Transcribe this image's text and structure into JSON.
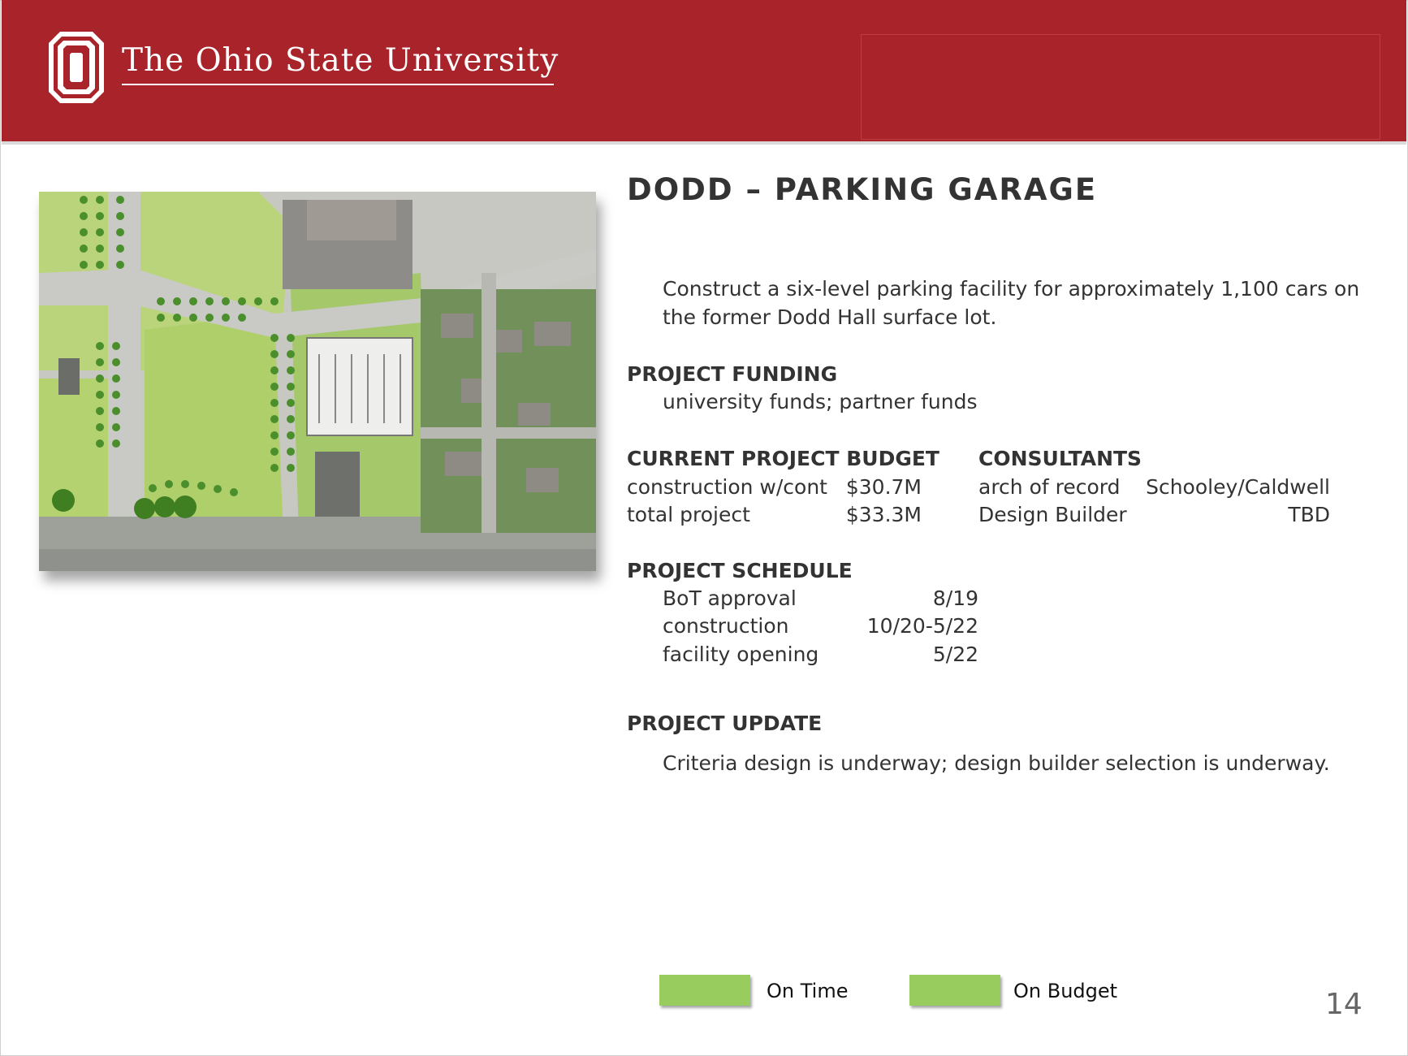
{
  "header": {
    "university_name": "The Ohio State University",
    "logo_icon": "block-o-logo-icon",
    "brand_color": "#a8232a"
  },
  "map": {
    "icon": "aerial-site-map-icon"
  },
  "title": "DODD – PARKING GARAGE",
  "description": "Construct a six-level parking facility for approximately 1,100 cars on the former Dodd Hall surface lot.",
  "funding": {
    "heading": "PROJECT FUNDING",
    "text": "university funds; partner funds"
  },
  "budget": {
    "heading": "CURRENT PROJECT BUDGET",
    "rows": [
      {
        "label": "construction w/cont",
        "value": "$30.7M"
      },
      {
        "label": "total project",
        "value": "$33.3M"
      }
    ]
  },
  "consultants": {
    "heading": "CONSULTANTS",
    "rows": [
      {
        "label": "arch of record",
        "value": "Schooley/Caldwell"
      },
      {
        "label": "Design Builder",
        "value": "TBD"
      }
    ]
  },
  "schedule": {
    "heading": "PROJECT SCHEDULE",
    "rows": [
      {
        "label": "BoT approval",
        "value": "8/19"
      },
      {
        "label": "construction",
        "value": "10/20-5/22"
      },
      {
        "label": "facility opening",
        "value": "5/22"
      }
    ]
  },
  "update": {
    "heading": "PROJECT UPDATE",
    "text": "Criteria design is underway; design builder selection is underway."
  },
  "legend": {
    "on_time": "On Time",
    "on_budget": "On Budget",
    "status_color": "#99cc5e"
  },
  "page_number": "14"
}
